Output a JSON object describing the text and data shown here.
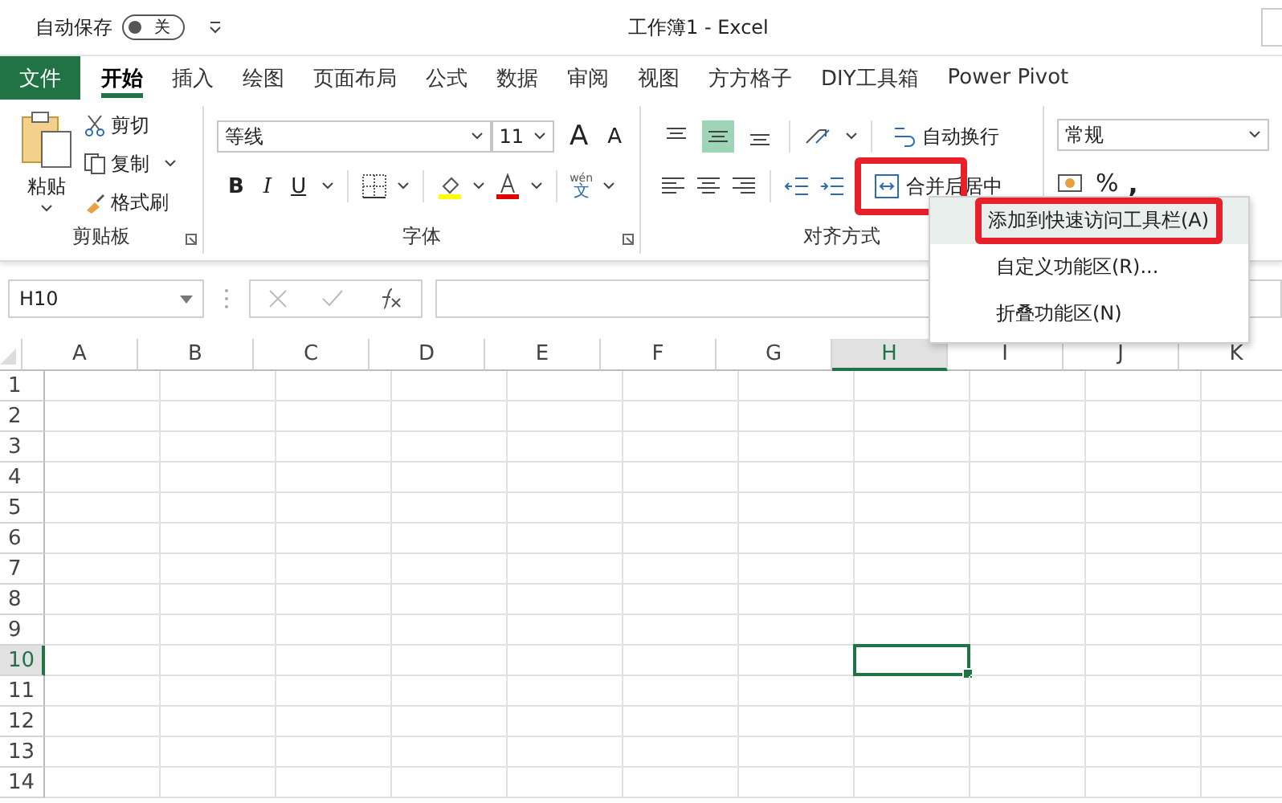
{
  "title_bar": {
    "autosave_label": "自动保存",
    "autosave_toggle": {
      "on": false,
      "label": "关"
    },
    "title": "工作簿1  -  Excel"
  },
  "tabs": [
    {
      "label": "文件",
      "kind": "file",
      "selected": false
    },
    {
      "label": "开始",
      "kind": "tab",
      "selected": true
    },
    {
      "label": "插入",
      "kind": "tab",
      "selected": false
    },
    {
      "label": "绘图",
      "kind": "tab",
      "selected": false
    },
    {
      "label": "页面布局",
      "kind": "tab",
      "selected": false
    },
    {
      "label": "公式",
      "kind": "tab",
      "selected": false
    },
    {
      "label": "数据",
      "kind": "tab",
      "selected": false
    },
    {
      "label": "审阅",
      "kind": "tab",
      "selected": false
    },
    {
      "label": "视图",
      "kind": "tab",
      "selected": false
    },
    {
      "label": "方方格子",
      "kind": "tab",
      "selected": false
    },
    {
      "label": "DIY工具箱",
      "kind": "tab",
      "selected": false
    },
    {
      "label": "Power Pivot",
      "kind": "tab",
      "selected": false
    }
  ],
  "ribbon": {
    "clipboard": {
      "label": "剪贴板",
      "paste": "粘贴",
      "cut": "剪切",
      "copy": "复制",
      "format_painter": "格式刷"
    },
    "font": {
      "label": "字体",
      "font_name": "等线",
      "font_size": "11",
      "grow": "A",
      "shrink": "A",
      "bold": "B",
      "italic": "I",
      "underline": "U",
      "phonetic_top": "wén",
      "phonetic_bottom": "文"
    },
    "alignment": {
      "label": "对齐方式",
      "vertical": [
        {
          "selected": false
        },
        {
          "selected": true
        },
        {
          "selected": false
        }
      ],
      "wrap": "自动换行",
      "merge": {
        "label": "合并后居中",
        "outlined": true
      }
    },
    "number": {
      "format": "常规",
      "percent": "%",
      "comma": ","
    }
  },
  "formula_bar": {
    "name_box": "H10"
  },
  "grid": {
    "columns": [
      {
        "label": "A",
        "selected": false
      },
      {
        "label": "B",
        "selected": false
      },
      {
        "label": "C",
        "selected": false
      },
      {
        "label": "D",
        "selected": false
      },
      {
        "label": "E",
        "selected": false
      },
      {
        "label": "F",
        "selected": false
      },
      {
        "label": "G",
        "selected": false
      },
      {
        "label": "H",
        "selected": true
      },
      {
        "label": "I",
        "selected": false
      },
      {
        "label": "J",
        "selected": false
      },
      {
        "label": "K",
        "selected": false
      }
    ],
    "rows": [
      {
        "label": "1",
        "selected": false
      },
      {
        "label": "2",
        "selected": false
      },
      {
        "label": "3",
        "selected": false
      },
      {
        "label": "4",
        "selected": false
      },
      {
        "label": "5",
        "selected": false
      },
      {
        "label": "6",
        "selected": false
      },
      {
        "label": "7",
        "selected": false
      },
      {
        "label": "8",
        "selected": false
      },
      {
        "label": "9",
        "selected": false
      },
      {
        "label": "10",
        "selected": true
      },
      {
        "label": "11",
        "selected": false
      },
      {
        "label": "12",
        "selected": false
      },
      {
        "label": "13",
        "selected": false
      },
      {
        "label": "14",
        "selected": false
      }
    ]
  },
  "context_menu": {
    "items": [
      {
        "label": "添加到快速访问工具栏(A)",
        "selected": true,
        "outlined": true
      },
      {
        "label": "自定义功能区(R)...",
        "selected": false,
        "outlined": false
      },
      {
        "label": "折叠功能区(N)",
        "selected": false,
        "outlined": false
      }
    ]
  }
}
